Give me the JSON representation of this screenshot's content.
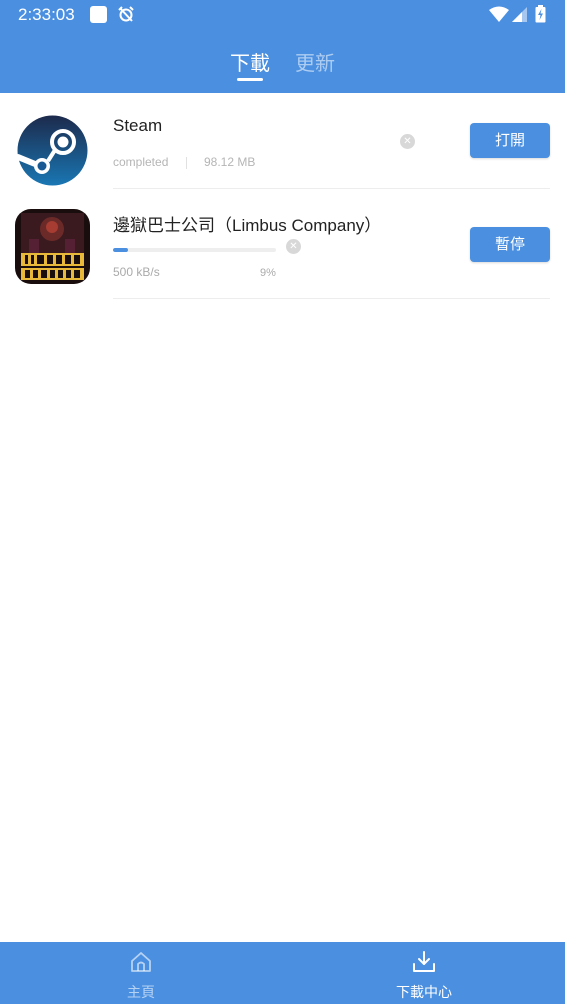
{
  "status_bar": {
    "time": "2:33:03"
  },
  "tabs": [
    {
      "label": "下載",
      "active": true
    },
    {
      "label": "更新",
      "active": false
    }
  ],
  "downloads": [
    {
      "name": "Steam",
      "icon": "steam-logo-icon",
      "status": "completed",
      "size": "98.12 MB",
      "action": "打開"
    },
    {
      "name": "邊獄巴士公司（Limbus Company）",
      "icon": "limbus-company-logo-icon",
      "speed": "500 kB/s",
      "progress_percent": 9,
      "progress_label": "9%",
      "action": "暫停"
    }
  ],
  "bottom_nav": [
    {
      "label": "主頁",
      "icon": "home-icon",
      "active": false
    },
    {
      "label": "下載中心",
      "icon": "download-icon",
      "active": true
    }
  ],
  "colors": {
    "accent": "#4a8fe0",
    "background": "#ffffff"
  }
}
